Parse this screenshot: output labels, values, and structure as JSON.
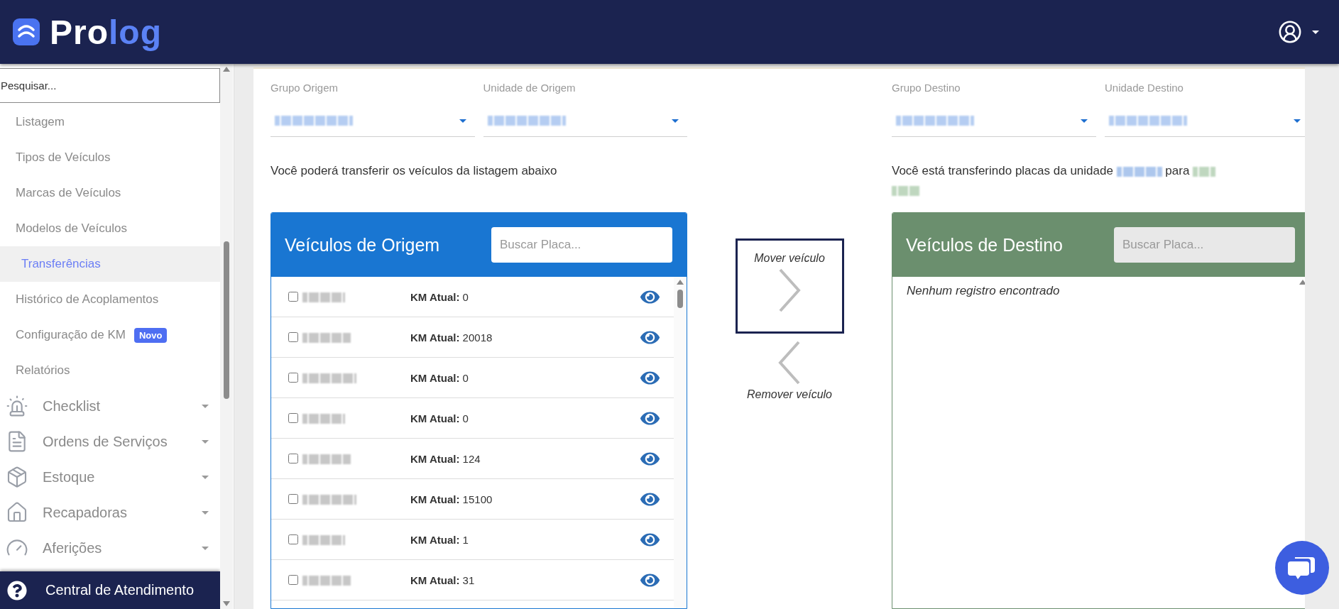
{
  "header": {
    "logo": [
      {
        "text": "Pro",
        "color": "#ffffff"
      },
      {
        "text": "log",
        "color": "#5b82f5"
      }
    ]
  },
  "sidebar": {
    "search": {
      "placeholder": "Pesquisar..."
    },
    "items": [
      {
        "label": "Listagem",
        "selected": false
      },
      {
        "label": "Tipos de Veículos",
        "selected": false
      },
      {
        "label": "Marcas de Veículos",
        "selected": false
      },
      {
        "label": "Modelos de Veículos",
        "selected": false
      },
      {
        "label": "Transferências",
        "selected": true
      },
      {
        "label": "Histórico de Acoplamentos",
        "selected": false
      },
      {
        "label": "Configuração de KM",
        "selected": false,
        "badge": "Novo"
      },
      {
        "label": "Relatórios",
        "selected": false
      }
    ],
    "sections": [
      {
        "label": "Checklist"
      },
      {
        "label": "Ordens de Serviços"
      },
      {
        "label": "Estoque"
      },
      {
        "label": "Recapadoras"
      },
      {
        "label": "Aferições"
      }
    ],
    "help": "Central de Atendimento"
  },
  "filters": {
    "origin": [
      {
        "label": "Grupo Origem"
      },
      {
        "label": "Unidade de Origem"
      }
    ],
    "destination": [
      {
        "label": "Grupo Destino"
      },
      {
        "label": "Unidade Destino"
      }
    ]
  },
  "origin_hint": "Você poderá transferir os veículos da listagem abaixo",
  "destination_hint": {
    "before": "Você está transferindo placas da unidade",
    "middle": "para"
  },
  "origin_panel": {
    "title": "Veículos de Origem",
    "search": {
      "placeholder": "Buscar Placa..."
    },
    "rows": [
      {
        "checked": false,
        "km": "**KM Atual:** 0"
      },
      {
        "checked": false,
        "km": "**KM Atual:** 20018"
      },
      {
        "checked": false,
        "km": "**KM Atual:** 0"
      },
      {
        "checked": false,
        "km": "**KM Atual:** 0"
      },
      {
        "checked": false,
        "km": "**KM Atual:** 124"
      },
      {
        "checked": false,
        "km": "**KM Atual:** 15100"
      },
      {
        "checked": false,
        "km": "**KM Atual:** 1"
      },
      {
        "checked": false,
        "km": "**KM Atual:** 31"
      }
    ]
  },
  "move": {
    "label": "Mover veículo",
    "selected": true
  },
  "remove": {
    "label": "Remover veículo",
    "selected": false
  },
  "destination_panel": {
    "title": "Veículos de Destino",
    "search": {
      "placeholder": "Buscar Placa..."
    },
    "empty": "Nenhum registro encontrado"
  }
}
